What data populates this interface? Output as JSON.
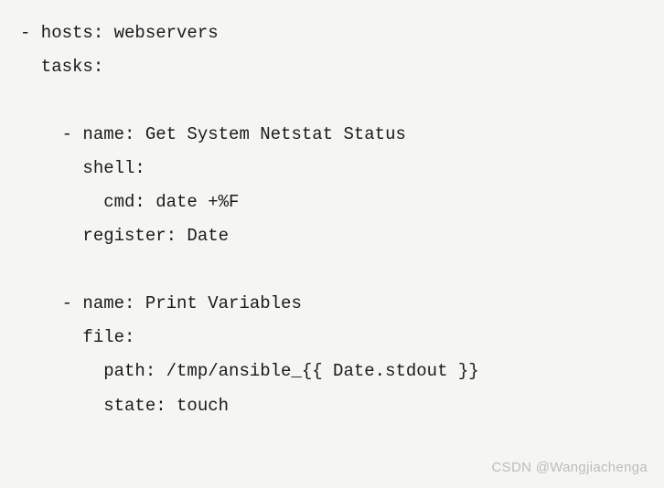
{
  "code": {
    "line1": "- hosts: webservers",
    "line2": "  tasks:",
    "blank1": "",
    "line3": "    - name: Get System Netstat Status",
    "line4": "      shell:",
    "line5": "        cmd: date +%F",
    "line6": "      register: Date",
    "blank2": "",
    "line7": "    - name: Print Variables",
    "line8": "      file:",
    "line9": "        path: /tmp/ansible_{{ Date.stdout }}",
    "line10": "        state: touch"
  },
  "watermark": "CSDN @Wangjiachenga"
}
